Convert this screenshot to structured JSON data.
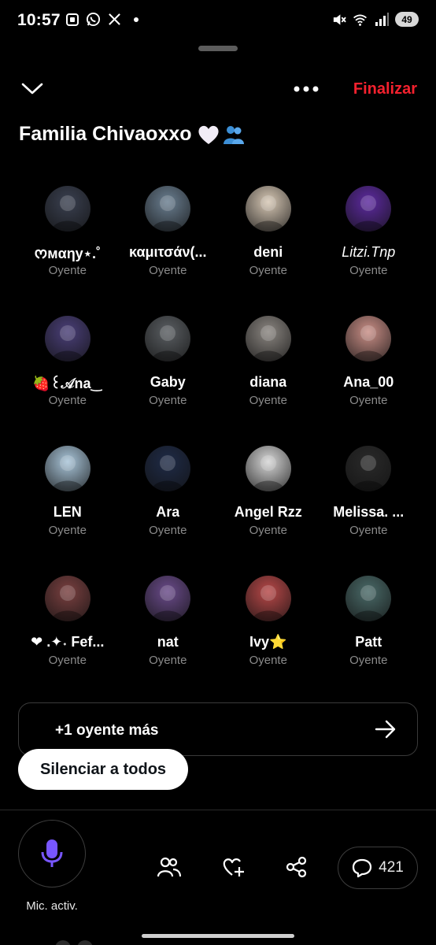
{
  "status_bar": {
    "time": "10:57",
    "battery": "49",
    "left_icons": [
      "screenshot-icon",
      "whatsapp-icon",
      "x-logo-icon",
      "dot-icon"
    ],
    "right_icons": [
      "mute-icon",
      "wifi-icon",
      "signal-icon",
      "battery-icon"
    ]
  },
  "header": {
    "end_label": "Finalizar",
    "accent_color": "#f4212e"
  },
  "space": {
    "title": "Familia Chivaoxxo",
    "title_emoji": [
      "white-heart",
      "two-people"
    ]
  },
  "participants": [
    {
      "name": "ᰔмαηу⋆.˚",
      "role": "Oyente",
      "avatar_color": "#3a4050"
    },
    {
      "name": "καμιτσάν(...",
      "role": "Oyente",
      "avatar_color": "#6a7e90"
    },
    {
      "name": "deni",
      "role": "Oyente",
      "avatar_color": "#d6c7b4"
    },
    {
      "name": "Litzi.Tnp",
      "role": "Oyente",
      "avatar_color": "#5d2aa0",
      "italic": true
    },
    {
      "name": "🍓꒰𝒜na‿",
      "role": "Oyente",
      "avatar_color": "#4a3f78"
    },
    {
      "name": "Gaby",
      "role": "Oyente",
      "avatar_color": "#5a5e62"
    },
    {
      "name": "diana",
      "role": "Oyente",
      "avatar_color": "#8a8580"
    },
    {
      "name": "Ana_00",
      "role": "Oyente",
      "avatar_color": "#c98e86"
    },
    {
      "name": "LEN",
      "role": "Oyente",
      "avatar_color": "#a8c4d8"
    },
    {
      "name": "Ara",
      "role": "Oyente",
      "avatar_color": "#1f2b47"
    },
    {
      "name": "Angel Rzz",
      "role": "Oyente",
      "avatar_color": "#d6d6d6"
    },
    {
      "name": "Melissa. ...",
      "role": "Oyente",
      "avatar_color": "#2a2a2a"
    },
    {
      "name": "❤ .✦˖ Fef...",
      "role": "Oyente",
      "avatar_color": "#7a4040"
    },
    {
      "name": "nat",
      "role": "Oyente",
      "avatar_color": "#6a4b8a"
    },
    {
      "name": "Ivy⭐",
      "role": "Oyente",
      "avatar_color": "#b84848"
    },
    {
      "name": "Patt",
      "role": "Oyente",
      "avatar_color": "#4a6a68"
    }
  ],
  "more_listeners": {
    "label": "+1 oyente más"
  },
  "mute_all": {
    "label": "Silenciar a todos"
  },
  "bottom_bar": {
    "mic_label": "Mic. activ.",
    "mic_color": "#7856ff",
    "comments_count": "421"
  }
}
